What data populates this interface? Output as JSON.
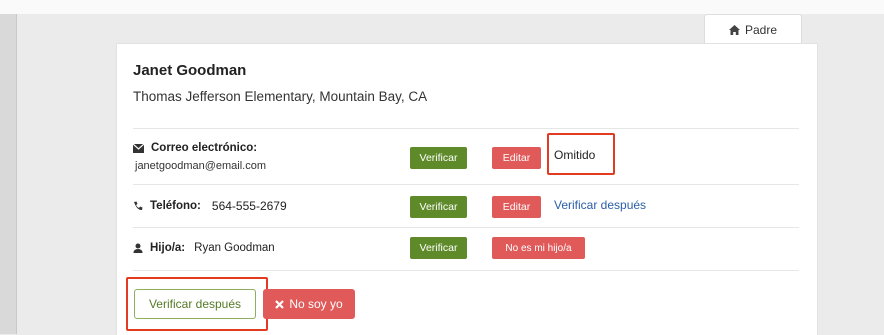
{
  "tab": {
    "label": "Padre",
    "icon": "home-icon"
  },
  "profile": {
    "name": "Janet Goodman",
    "school": "Thomas Jefferson Elementary, Mountain Bay, CA"
  },
  "email_row": {
    "label": "Correo electrónico:",
    "value": "janetgoodman@email.com",
    "verify_label": "Verificar",
    "edit_label": "Editar",
    "status": "Omitido"
  },
  "phone_row": {
    "label": "Teléfono:",
    "value": "564-555-2679",
    "verify_label": "Verificar",
    "edit_label": "Editar",
    "later_link": "Verificar después"
  },
  "child_row": {
    "label": "Hijo/a:",
    "value": "Ryan Goodman",
    "verify_label": "Verificar",
    "not_child_label": "No es mi hijo/a"
  },
  "footer": {
    "verify_later_label": "Verificar después",
    "not_me_label": "No soy yo"
  },
  "colors": {
    "accent_green": "#5e8a2a",
    "danger_red": "#e05a5a",
    "highlight": "#e33b22",
    "link_blue": "#2a5ea8"
  }
}
